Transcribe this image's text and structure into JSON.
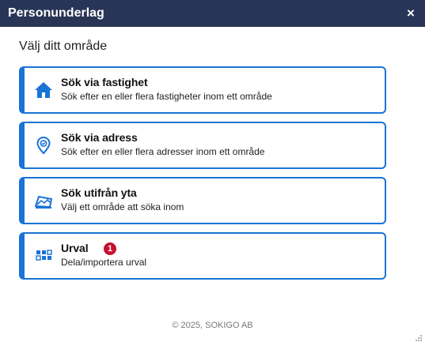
{
  "dialog": {
    "title": "Personunderlag",
    "close_label": "×"
  },
  "heading": "Välj ditt område",
  "options": [
    {
      "title": "Sök via fastighet",
      "description": "Sök efter en eller flera fastigheter inom ett område",
      "icon": "house-icon"
    },
    {
      "title": "Sök via adress",
      "description": "Sök efter en eller flera adresser inom ett område",
      "icon": "location-pin-icon"
    },
    {
      "title": "Sök utifrån yta",
      "description": "Välj ett område att söka inom",
      "icon": "map-area-icon"
    },
    {
      "title": "Urval",
      "description": "Dela/importera urval",
      "icon": "grid-icon",
      "badge": "1"
    }
  ],
  "footer": "© 2025, SOKIGO AB",
  "colors": {
    "titlebar": "#283556",
    "accent": "#1a73d6",
    "badge": "#c8102e"
  }
}
